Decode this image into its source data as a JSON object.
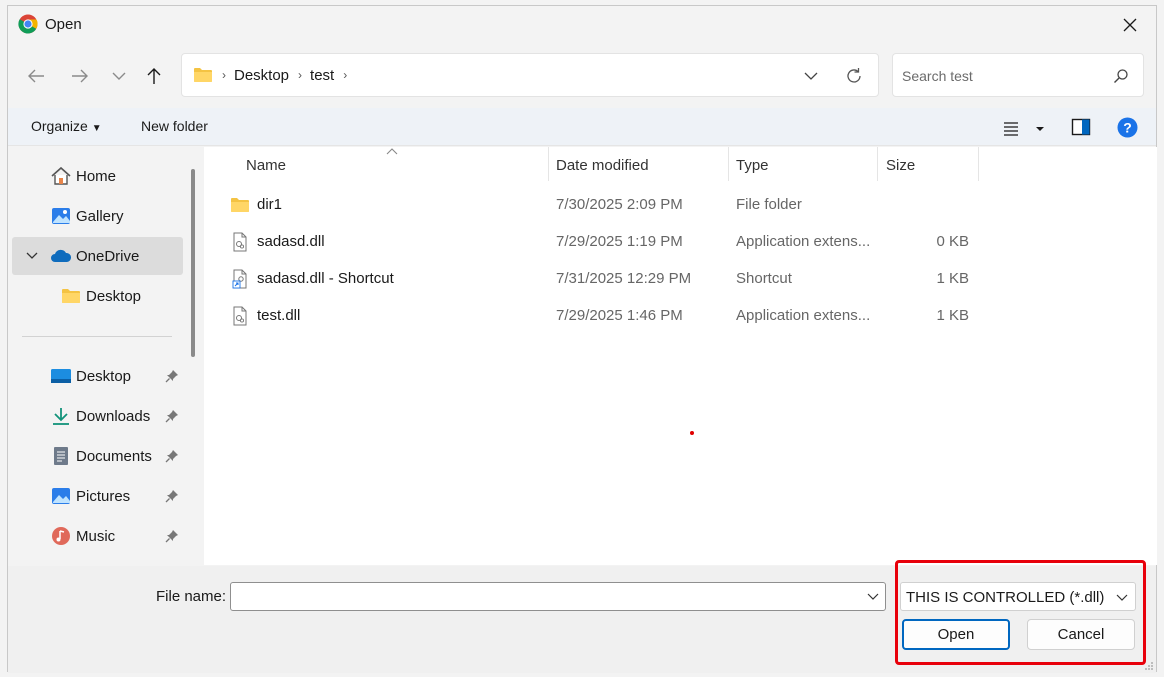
{
  "window": {
    "title": "Open"
  },
  "nav": {
    "breadcrumbs": [
      "Desktop",
      "test"
    ],
    "search_placeholder": "Search test"
  },
  "commands": {
    "organize": "Organize",
    "new_folder": "New folder"
  },
  "sidebar": {
    "items": [
      {
        "label": "Home",
        "icon": "home-icon"
      },
      {
        "label": "Gallery",
        "icon": "gallery-icon"
      },
      {
        "label": "OneDrive",
        "icon": "onedrive-icon",
        "selected": true
      },
      {
        "label": "Desktop",
        "icon": "folder-icon"
      },
      {
        "label": "Desktop",
        "icon": "desktop-icon",
        "pinned": true
      },
      {
        "label": "Downloads",
        "icon": "download-icon",
        "pinned": true
      },
      {
        "label": "Documents",
        "icon": "document-icon",
        "pinned": true
      },
      {
        "label": "Pictures",
        "icon": "pictures-icon",
        "pinned": true
      },
      {
        "label": "Music",
        "icon": "music-icon",
        "pinned": true
      }
    ]
  },
  "columns": {
    "name": "Name",
    "date": "Date modified",
    "type": "Type",
    "size": "Size"
  },
  "files": [
    {
      "name": "dir1",
      "date": "7/30/2025 2:09 PM",
      "type": "File folder",
      "size": "",
      "icon": "folder-icon"
    },
    {
      "name": "sadasd.dll",
      "date": "7/29/2025 1:19 PM",
      "type": "Application extens...",
      "size": "0 KB",
      "icon": "dll-file-icon"
    },
    {
      "name": "sadasd.dll - Shortcut",
      "date": "7/31/2025 12:29 PM",
      "type": "Shortcut",
      "size": "1 KB",
      "icon": "shortcut-icon"
    },
    {
      "name": "test.dll",
      "date": "7/29/2025 1:46 PM",
      "type": "Application extens...",
      "size": "1 KB",
      "icon": "dll-file-icon"
    }
  ],
  "bottom": {
    "file_name_label": "File name:",
    "file_name_value": "",
    "filter": "THIS IS CONTROLLED (*.dll)",
    "open_label": "Open",
    "cancel_label": "Cancel"
  },
  "colors": {
    "accent": "#0067c0",
    "highlight": "#e8000b",
    "folder": "#f4c343"
  }
}
